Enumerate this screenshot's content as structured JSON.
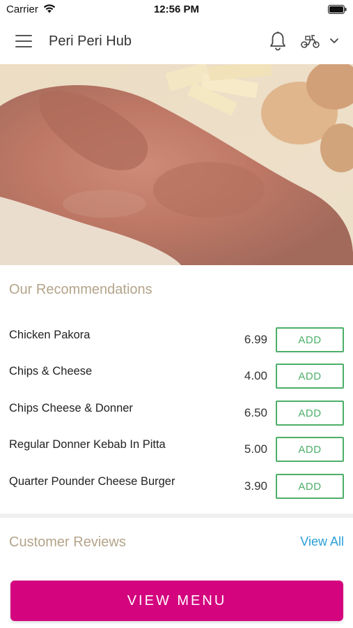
{
  "status_bar": {
    "carrier": "Carrier",
    "time": "12:56 PM"
  },
  "header": {
    "title": "Peri Peri Hub",
    "icons": [
      "menu-icon",
      "bell-icon",
      "scooter-icon",
      "chevron-down-icon"
    ]
  },
  "hero": {
    "icon": "food-photo"
  },
  "recommendations": {
    "title": "Our Recommendations",
    "items": [
      {
        "name": "Chicken Pakora",
        "price": "6.99",
        "button": "ADD"
      },
      {
        "name": "Chips & Cheese",
        "price": "4.00",
        "button": "ADD"
      },
      {
        "name": "Chips Cheese & Donner",
        "price": "6.50",
        "button": "ADD"
      },
      {
        "name": "Regular Donner Kebab In Pitta",
        "price": "5.00",
        "button": "ADD"
      },
      {
        "name": "Quarter Pounder Cheese Burger",
        "price": "3.90",
        "button": "ADD"
      }
    ]
  },
  "reviews": {
    "title": "Customer Reviews",
    "view_all": "View All"
  },
  "footer": {
    "button_label": "VIEW MENU"
  },
  "colors": {
    "accent": "#d4047f",
    "add_green": "#4caf68",
    "section_title": "#b3a48a",
    "link_blue": "#2a9fd6"
  }
}
